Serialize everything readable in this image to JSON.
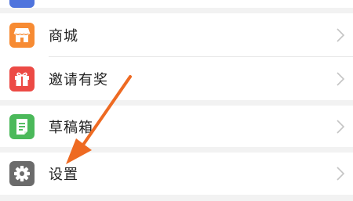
{
  "colors": {
    "page_bg": "#f2f2f2",
    "top_partial_icon": "#4f74dd",
    "shop_icon": "#f78b33",
    "invite_icon": "#ec4a45",
    "drafts_icon": "#4bb95a",
    "settings_icon": "#6b6b6b",
    "annotation_arrow": "#ee6a22"
  },
  "menu": {
    "items": [
      {
        "label": "商城",
        "icon": "store-icon"
      },
      {
        "label": "邀请有奖",
        "icon": "gift-icon"
      },
      {
        "label": "草稿箱",
        "icon": "draft-icon"
      },
      {
        "label": "设置",
        "icon": "gear-icon"
      }
    ]
  }
}
